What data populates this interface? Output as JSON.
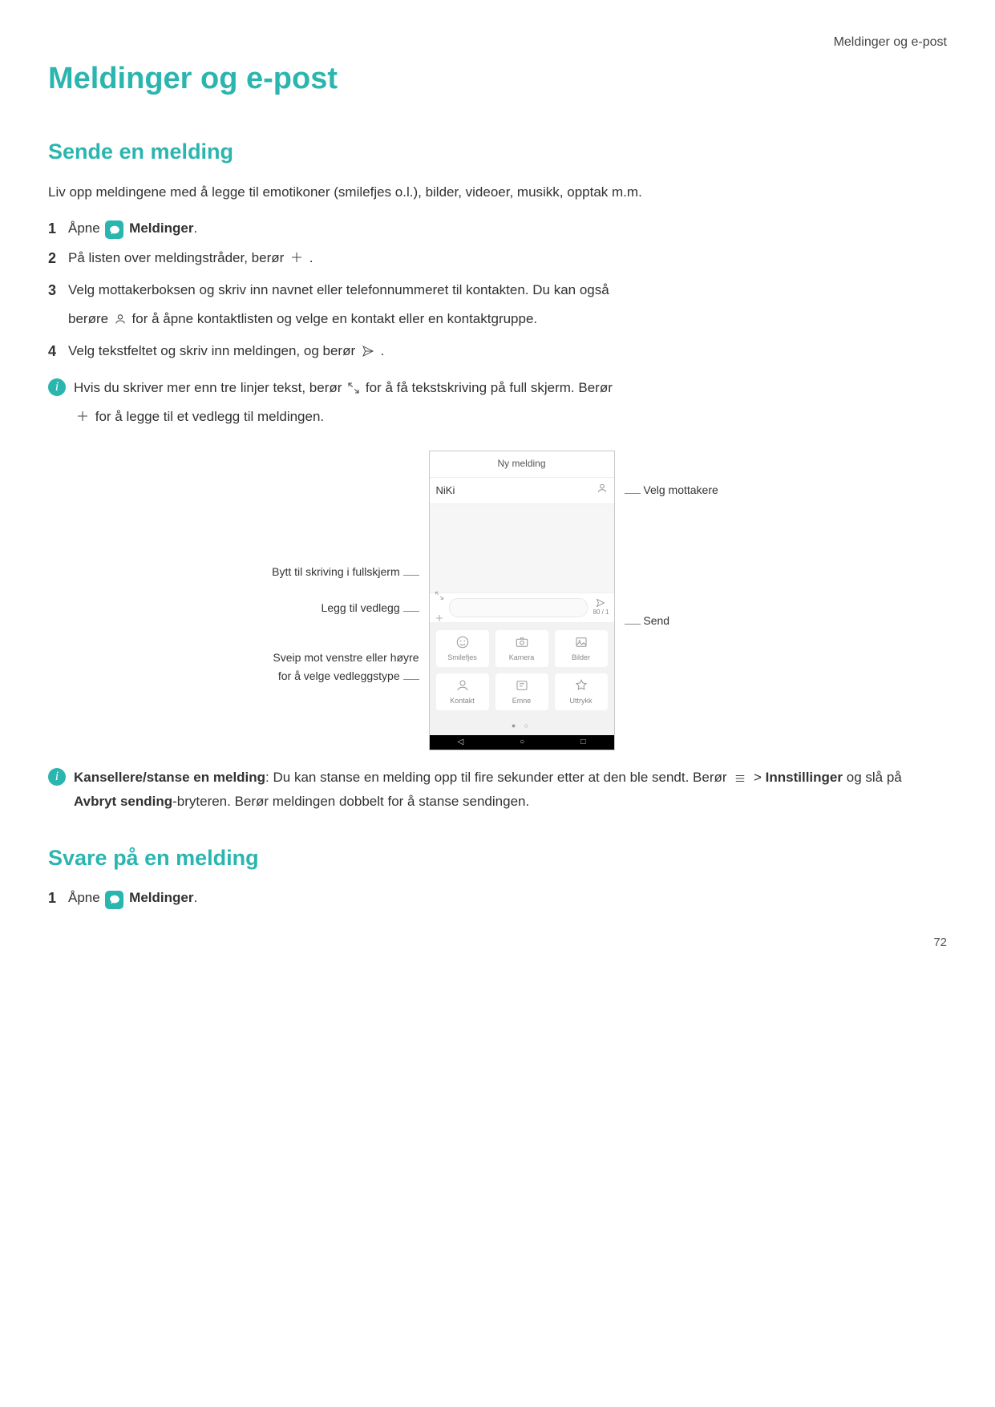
{
  "header": {
    "crumb": "Meldinger og e-post"
  },
  "title": "Meldinger og e-post",
  "section1": {
    "heading": "Sende en melding",
    "intro": "Liv opp meldingene med å legge til emotikoner (smilefjes o.l.), bilder, videoer, musikk, opptak m.m.",
    "steps": [
      {
        "num": "1",
        "before": "Åpne ",
        "bold": "Meldinger",
        "after": ".",
        "icon": "app"
      },
      {
        "num": "2",
        "before": "På listen over meldingstråder, berør ",
        "after": " .",
        "icon": "plus"
      },
      {
        "num": "3",
        "before": "Velg mottakerboksen og skriv inn navnet eller telefonnummeret til kontakten. Du kan også",
        "sub_before": "berøre ",
        "sub_after": " for å åpne kontaktlisten og velge en kontakt eller en kontaktgruppe.",
        "sub_icon": "person"
      },
      {
        "num": "4",
        "before": "Velg tekstfeltet og skriv inn meldingen, og berør ",
        "after": " .",
        "icon": "send"
      }
    ],
    "note1": {
      "part1_before": "Hvis du skriver mer enn tre linjer tekst, berør ",
      "part1_after": " for å få tekstskriving på full skjerm. Berør ",
      "part2_after": " for å legge til et vedlegg til meldingen."
    },
    "callouts": {
      "left1": "Bytt til skriving i fullskjerm",
      "left2": "Legg til vedlegg",
      "left3": "Sveip mot venstre eller høyre for å velge vedleggstype",
      "right1": "Velg mottakere",
      "right2": "Send"
    },
    "phone": {
      "title": "Ny melding",
      "to": "NiKi",
      "send_count": "80 / 1",
      "tiles": [
        "Smilefjes",
        "Kamera",
        "Bilder",
        "Kontakt",
        "Emne",
        "Uttrykk"
      ]
    },
    "note2": {
      "bold_lead": "Kansellere/stanse en melding",
      "t1": ": Du kan stanse en melding opp til fire sekunder etter at den ",
      "t2": "ble sendt. Berør ",
      "t3": " > ",
      "bold_settings": "Innstillinger",
      "t4": " og slå på ",
      "bold_cancel": "Avbryt sending",
      "t5": "-bryteren. Berør meldingen dobbelt for å stanse sendingen."
    }
  },
  "section2": {
    "heading": "Svare på en melding",
    "step": {
      "num": "1",
      "before": "Åpne ",
      "bold": "Meldinger",
      "after": "."
    }
  },
  "page_number": "72"
}
